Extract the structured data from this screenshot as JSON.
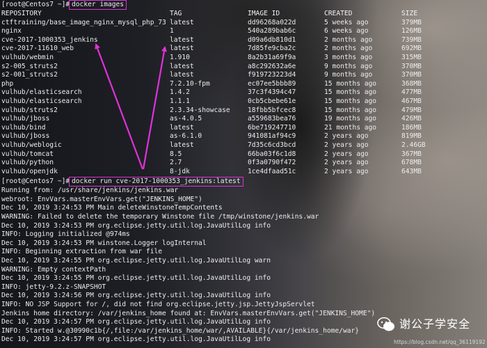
{
  "prompt": "[root@Centos7 ~]#",
  "command1": "docker images",
  "headers": [
    "REPOSITORY",
    "TAG",
    "IMAGE ID",
    "CREATED",
    "SIZE"
  ],
  "images": [
    [
      "ctftraining/base_image_nginx_mysql_php_73",
      "latest",
      "dd96268a022d",
      "5 weeks ago",
      "379MB"
    ],
    [
      "nginx",
      "1",
      "540a289bab6c",
      "6 weeks ago",
      "126MB"
    ],
    [
      "cve-2017-1000353_jenkins",
      "latest",
      "d09a6db810d1",
      "2 months ago",
      "739MB"
    ],
    [
      "cve-2017-11610_web",
      "latest",
      "7d85fe9cba2c",
      "2 months ago",
      "692MB"
    ],
    [
      "vulhub/webmin",
      "1.910",
      "8a2b31a69f9a",
      "3 months ago",
      "315MB"
    ],
    [
      "s2-005_struts2",
      "latest",
      "a8c292632a6e",
      "9 months ago",
      "370MB"
    ],
    [
      "s2-001_struts2",
      "latest",
      "f919723223d4",
      "9 months ago",
      "370MB"
    ],
    [
      "php",
      "7.2.10-fpm",
      "ec07ee5bbb89",
      "15 months ago",
      "368MB"
    ],
    [
      "vulhub/elasticsearch",
      "1.4.2",
      "37c3f4394c47",
      "15 months ago",
      "477MB"
    ],
    [
      "vulhub/elasticsearch",
      "1.1.1",
      "0cb5cbebe61e",
      "15 months ago",
      "467MB"
    ],
    [
      "vulhub/struts2",
      "2.3.34-showcase",
      "18fbb5bfcec8",
      "15 months ago",
      "479MB"
    ],
    [
      "vulhub/jboss",
      "as-4.0.5",
      "a559683bea76",
      "19 months ago",
      "426MB"
    ],
    [
      "vulhub/bind",
      "latest",
      "6be719247710",
      "21 months ago",
      "186MB"
    ],
    [
      "vulhub/jboss",
      "as-6.1.0",
      "941081af94c9",
      "2 years ago",
      "819MB"
    ],
    [
      "vulhub/weblogic",
      "latest",
      "7d35c6cd3bcd",
      "2 years ago",
      "2.46GB"
    ],
    [
      "vulhub/tomcat",
      "8.5",
      "66ba03f6c1d8",
      "2 years ago",
      "367MB"
    ],
    [
      "vulhub/python",
      "2.7",
      "0f3a0790f472",
      "2 years ago",
      "678MB"
    ],
    [
      "vulhub/openjdk",
      "8-jdk",
      "1ce4dfaad51c",
      "2 years ago",
      "643MB"
    ]
  ],
  "command2": "docker run cve-2017-1000353_jenkins:latest",
  "log": [
    "Running from: /usr/share/jenkins/jenkins.war",
    "webroot: EnvVars.masterEnvVars.get(\"JENKINS_HOME\")",
    "Dec 10, 2019 3:24:53 PM Main deleteWinstoneTempContents",
    "WARNING: Failed to delete the temporary Winstone file /tmp/winstone/jenkins.war",
    "Dec 10, 2019 3:24:53 PM org.eclipse.jetty.util.log.JavaUtilLog info",
    "INFO: Logging initialized @974ms",
    "Dec 10, 2019 3:24:53 PM winstone.Logger logInternal",
    "INFO: Beginning extraction from war file",
    "Dec 10, 2019 3:24:55 PM org.eclipse.jetty.util.log.JavaUtilLog warn",
    "WARNING: Empty contextPath",
    "Dec 10, 2019 3:24:55 PM org.eclipse.jetty.util.log.JavaUtilLog info",
    "INFO: jetty-9.2.z-SNAPSHOT",
    "Dec 10, 2019 3:24:56 PM org.eclipse.jetty.util.log.JavaUtilLog info",
    "INFO: NO JSP Support for /, did not find org.eclipse.jetty.jsp.JettyJspServlet",
    "Jenkins home directory: /var/jenkins_home found at: EnvVars.masterEnvVars.get(\"JENKINS_HOME\")",
    "Dec 10, 2019 3:24:57 PM org.eclipse.jetty.util.log.JavaUtilLog info",
    "INFO: Started w.@30990c1b{/,file:/var/jenkins_home/war/,AVAILABLE}{/var/jenkins_home/war}",
    "Dec 10, 2019 3:24:57 PM org.eclipse.jetty.util.log.JavaUtilLog info"
  ],
  "watermark": {
    "name": "谢公子学安全",
    "url": "https://blog.csdn.net/qq_36119192"
  },
  "colors": {
    "highlight": "#e032d8",
    "text": "#ececec"
  }
}
